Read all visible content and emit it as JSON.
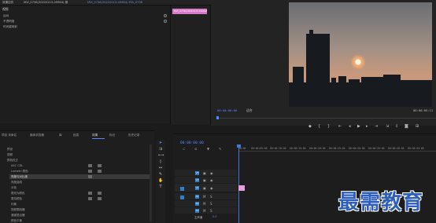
{
  "top_tabs": {
    "tab1": "效果控件",
    "tab2": "MVI_0736(20220215-09964) 源",
    "tab3": "MVI_0736(20220215-09964) MVI_0736",
    "mini_clip": "MVI_0736(20220215-0996#B"
  },
  "effect_controls": {
    "header": "视频",
    "rows": [
      "运动",
      "不透明度",
      "时间重映射"
    ]
  },
  "program": {
    "timecode_left": "00:00:00:00",
    "fit_label": "适合",
    "timecode_right": "00:00:05:11",
    "accent": "#4f8cff"
  },
  "project_panel": {
    "tabs": [
      "项目 未命名",
      "媒体浏览器",
      "库",
      "信息",
      "效果",
      "标记",
      "历史记录"
    ],
    "active_tab": "效果",
    "rows": [
      "预设",
      "视频",
      "颜色校正",
      "ASC CDL",
      "Lumetri 颜色",
      "亮度与对比度",
      "亮度曲线",
      "分色",
      "更改为颜色",
      "更改颜色",
      "均衡",
      "视频限制器",
      "通道混合器",
      "颜色平衡"
    ],
    "selected_row": "亮度与对比度"
  },
  "timeline": {
    "timecode": "00:00:00:00",
    "ruler": [
      "00:00",
      "00:00:05:00",
      "00:00:10:00",
      "00:00:15:00",
      "00:00:20:00",
      "00:00:25:00",
      "00:00:30:00",
      "00:00:35:00",
      "00:00:40:00",
      "00:00:45:00",
      "00:00:50:00"
    ],
    "tracks": [
      "V3",
      "V2",
      "V1",
      "A1",
      "A2",
      "A3",
      "主声道"
    ],
    "master_value": "0.0"
  },
  "watermark": "最需教育"
}
